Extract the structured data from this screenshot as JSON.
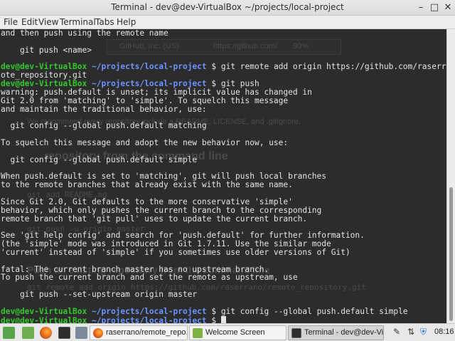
{
  "window": {
    "title": "Terminal - dev@dev-VirtualBox ~/projects/local-project",
    "minimize_glyph": "–",
    "maximize_glyph": "□",
    "close_glyph": "✕"
  },
  "menu": {
    "file": "File",
    "edit": "Edit",
    "view": "View",
    "terminal": "Terminal",
    "tabs": "Tabs",
    "help": "Help"
  },
  "terminal": {
    "prompt_user": "dev@dev-VirtualBox",
    "prompt_path": "~/projects/local-project",
    "lines": [
      {
        "type": "out",
        "text": "and then push using the remote name"
      },
      {
        "type": "out",
        "text": ""
      },
      {
        "type": "out",
        "text": "    git push <name>"
      },
      {
        "type": "out",
        "text": ""
      },
      {
        "type": "prompt",
        "cmd": " $ git remote add origin https://github.com/raserrano/rem"
      },
      {
        "type": "out",
        "text": "ote_repository.git"
      },
      {
        "type": "prompt",
        "cmd": " $ git push"
      },
      {
        "type": "out",
        "text": "warning: push.default is unset; its implicit value has changed in"
      },
      {
        "type": "out",
        "text": "Git 2.0 from 'matching' to 'simple'. To squelch this message"
      },
      {
        "type": "out",
        "text": "and maintain the traditional behavior, use:"
      },
      {
        "type": "out",
        "text": ""
      },
      {
        "type": "out",
        "text": "  git config --global push.default matching"
      },
      {
        "type": "out",
        "text": ""
      },
      {
        "type": "out",
        "text": "To squelch this message and adopt the new behavior now, use:"
      },
      {
        "type": "out",
        "text": ""
      },
      {
        "type": "out",
        "text": "  git config --global push.default simple"
      },
      {
        "type": "out",
        "text": ""
      },
      {
        "type": "out",
        "text": "When push.default is set to 'matching', git will push local branches"
      },
      {
        "type": "out",
        "text": "to the remote branches that already exist with the same name."
      },
      {
        "type": "out",
        "text": ""
      },
      {
        "type": "out",
        "text": "Since Git 2.0, Git defaults to the more conservative 'simple'"
      },
      {
        "type": "out",
        "text": "behavior, which only pushes the current branch to the corresponding"
      },
      {
        "type": "out",
        "text": "remote branch that 'git pull' uses to update the current branch."
      },
      {
        "type": "out",
        "text": ""
      },
      {
        "type": "out",
        "text": "See 'git help config' and search for 'push.default' for further information."
      },
      {
        "type": "out",
        "text": "(the 'simple' mode was introduced in Git 1.7.11. Use the similar mode"
      },
      {
        "type": "out",
        "text": "'current' instead of 'simple' if you sometimes use older versions of Git)"
      },
      {
        "type": "out",
        "text": ""
      },
      {
        "type": "out",
        "text": "fatal: The current branch master has no upstream branch."
      },
      {
        "type": "out",
        "text": "To push the current branch and set the remote as upstream, use"
      },
      {
        "type": "out",
        "text": ""
      },
      {
        "type": "out",
        "text": "    git push --set-upstream origin master"
      },
      {
        "type": "out",
        "text": ""
      },
      {
        "type": "prompt",
        "cmd": " $ git config --global push.default simple"
      },
      {
        "type": "prompt_cursor",
        "cmd": " $ "
      }
    ]
  },
  "background_browser": {
    "identity": "GitHub, Inc. (US)",
    "url": "https://github.com/",
    "zoom": "90%",
    "heading1": "repository from the command line",
    "heading2": "Push an existing repository from the command line",
    "code1": "git add README.md",
    "code2": "git push -u origin master",
    "code3": "git remote add origin https://github.com/raserrano/remote_repository.git",
    "readme_text": "We recommend every repository include a README, LICENSE, and .gitignore."
  },
  "taskbar": {
    "items": [
      {
        "label": "raserrano/remote_repo..."
      },
      {
        "label": "Welcome Screen"
      },
      {
        "label": "Terminal - dev@dev-Virt..."
      }
    ],
    "clock": "08:16"
  },
  "colors": {
    "terminal_bg": "#2c2c2c",
    "prompt_user": "#35c72e",
    "prompt_path": "#6d93ff",
    "text": "#e4e4e4"
  }
}
